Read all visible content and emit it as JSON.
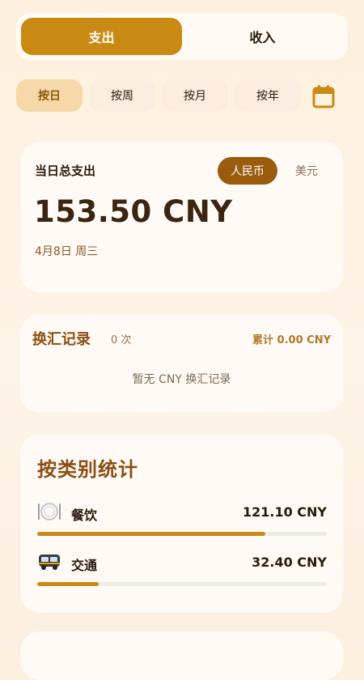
{
  "segment": {
    "tabs": [
      {
        "label": "支出",
        "active": true
      },
      {
        "label": "收入",
        "active": false
      }
    ]
  },
  "period": {
    "tabs": [
      {
        "label": "按日",
        "active": true
      },
      {
        "label": "按周"
      },
      {
        "label": "按月"
      },
      {
        "label": "按年"
      }
    ],
    "calendar_icon": "calendar-icon"
  },
  "summary": {
    "title": "当日总支出",
    "currency_options": [
      {
        "label": "人民币",
        "active": true
      },
      {
        "label": "美元",
        "active": false
      }
    ],
    "amount": "153.50 CNY",
    "date": "4月8日 周三"
  },
  "exchange": {
    "title": "换汇记录",
    "count": "0 次",
    "total": "累计 0.00 CNY",
    "empty_text": "暂无 CNY 换汇记录"
  },
  "categories": {
    "title": "按类别统计",
    "items": [
      {
        "name": "餐饮",
        "icon": "plate-icon",
        "amount": "121.10 CNY",
        "share": 0.789
      },
      {
        "name": "交通",
        "icon": "bus-icon",
        "amount": "32.40 CNY",
        "share": 0.211
      }
    ]
  },
  "colors": {
    "accent": "#c98a14",
    "accent_dark": "#9a5b0c",
    "title_brown": "#8a4e12"
  }
}
